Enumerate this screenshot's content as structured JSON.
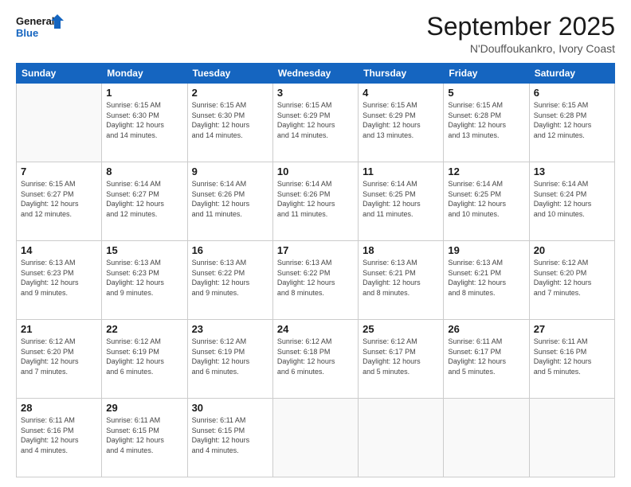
{
  "logo": {
    "line1": "General",
    "line2": "Blue"
  },
  "header": {
    "month": "September 2025",
    "location": "N'Douffoukankro, Ivory Coast"
  },
  "days_of_week": [
    "Sunday",
    "Monday",
    "Tuesday",
    "Wednesday",
    "Thursday",
    "Friday",
    "Saturday"
  ],
  "weeks": [
    [
      {
        "day": "",
        "info": ""
      },
      {
        "day": "1",
        "info": "Sunrise: 6:15 AM\nSunset: 6:30 PM\nDaylight: 12 hours\nand 14 minutes."
      },
      {
        "day": "2",
        "info": "Sunrise: 6:15 AM\nSunset: 6:30 PM\nDaylight: 12 hours\nand 14 minutes."
      },
      {
        "day": "3",
        "info": "Sunrise: 6:15 AM\nSunset: 6:29 PM\nDaylight: 12 hours\nand 14 minutes."
      },
      {
        "day": "4",
        "info": "Sunrise: 6:15 AM\nSunset: 6:29 PM\nDaylight: 12 hours\nand 13 minutes."
      },
      {
        "day": "5",
        "info": "Sunrise: 6:15 AM\nSunset: 6:28 PM\nDaylight: 12 hours\nand 13 minutes."
      },
      {
        "day": "6",
        "info": "Sunrise: 6:15 AM\nSunset: 6:28 PM\nDaylight: 12 hours\nand 12 minutes."
      }
    ],
    [
      {
        "day": "7",
        "info": "Sunrise: 6:15 AM\nSunset: 6:27 PM\nDaylight: 12 hours\nand 12 minutes."
      },
      {
        "day": "8",
        "info": "Sunrise: 6:14 AM\nSunset: 6:27 PM\nDaylight: 12 hours\nand 12 minutes."
      },
      {
        "day": "9",
        "info": "Sunrise: 6:14 AM\nSunset: 6:26 PM\nDaylight: 12 hours\nand 11 minutes."
      },
      {
        "day": "10",
        "info": "Sunrise: 6:14 AM\nSunset: 6:26 PM\nDaylight: 12 hours\nand 11 minutes."
      },
      {
        "day": "11",
        "info": "Sunrise: 6:14 AM\nSunset: 6:25 PM\nDaylight: 12 hours\nand 11 minutes."
      },
      {
        "day": "12",
        "info": "Sunrise: 6:14 AM\nSunset: 6:25 PM\nDaylight: 12 hours\nand 10 minutes."
      },
      {
        "day": "13",
        "info": "Sunrise: 6:14 AM\nSunset: 6:24 PM\nDaylight: 12 hours\nand 10 minutes."
      }
    ],
    [
      {
        "day": "14",
        "info": "Sunrise: 6:13 AM\nSunset: 6:23 PM\nDaylight: 12 hours\nand 9 minutes."
      },
      {
        "day": "15",
        "info": "Sunrise: 6:13 AM\nSunset: 6:23 PM\nDaylight: 12 hours\nand 9 minutes."
      },
      {
        "day": "16",
        "info": "Sunrise: 6:13 AM\nSunset: 6:22 PM\nDaylight: 12 hours\nand 9 minutes."
      },
      {
        "day": "17",
        "info": "Sunrise: 6:13 AM\nSunset: 6:22 PM\nDaylight: 12 hours\nand 8 minutes."
      },
      {
        "day": "18",
        "info": "Sunrise: 6:13 AM\nSunset: 6:21 PM\nDaylight: 12 hours\nand 8 minutes."
      },
      {
        "day": "19",
        "info": "Sunrise: 6:13 AM\nSunset: 6:21 PM\nDaylight: 12 hours\nand 8 minutes."
      },
      {
        "day": "20",
        "info": "Sunrise: 6:12 AM\nSunset: 6:20 PM\nDaylight: 12 hours\nand 7 minutes."
      }
    ],
    [
      {
        "day": "21",
        "info": "Sunrise: 6:12 AM\nSunset: 6:20 PM\nDaylight: 12 hours\nand 7 minutes."
      },
      {
        "day": "22",
        "info": "Sunrise: 6:12 AM\nSunset: 6:19 PM\nDaylight: 12 hours\nand 6 minutes."
      },
      {
        "day": "23",
        "info": "Sunrise: 6:12 AM\nSunset: 6:19 PM\nDaylight: 12 hours\nand 6 minutes."
      },
      {
        "day": "24",
        "info": "Sunrise: 6:12 AM\nSunset: 6:18 PM\nDaylight: 12 hours\nand 6 minutes."
      },
      {
        "day": "25",
        "info": "Sunrise: 6:12 AM\nSunset: 6:17 PM\nDaylight: 12 hours\nand 5 minutes."
      },
      {
        "day": "26",
        "info": "Sunrise: 6:11 AM\nSunset: 6:17 PM\nDaylight: 12 hours\nand 5 minutes."
      },
      {
        "day": "27",
        "info": "Sunrise: 6:11 AM\nSunset: 6:16 PM\nDaylight: 12 hours\nand 5 minutes."
      }
    ],
    [
      {
        "day": "28",
        "info": "Sunrise: 6:11 AM\nSunset: 6:16 PM\nDaylight: 12 hours\nand 4 minutes."
      },
      {
        "day": "29",
        "info": "Sunrise: 6:11 AM\nSunset: 6:15 PM\nDaylight: 12 hours\nand 4 minutes."
      },
      {
        "day": "30",
        "info": "Sunrise: 6:11 AM\nSunset: 6:15 PM\nDaylight: 12 hours\nand 4 minutes."
      },
      {
        "day": "",
        "info": ""
      },
      {
        "day": "",
        "info": ""
      },
      {
        "day": "",
        "info": ""
      },
      {
        "day": "",
        "info": ""
      }
    ]
  ]
}
